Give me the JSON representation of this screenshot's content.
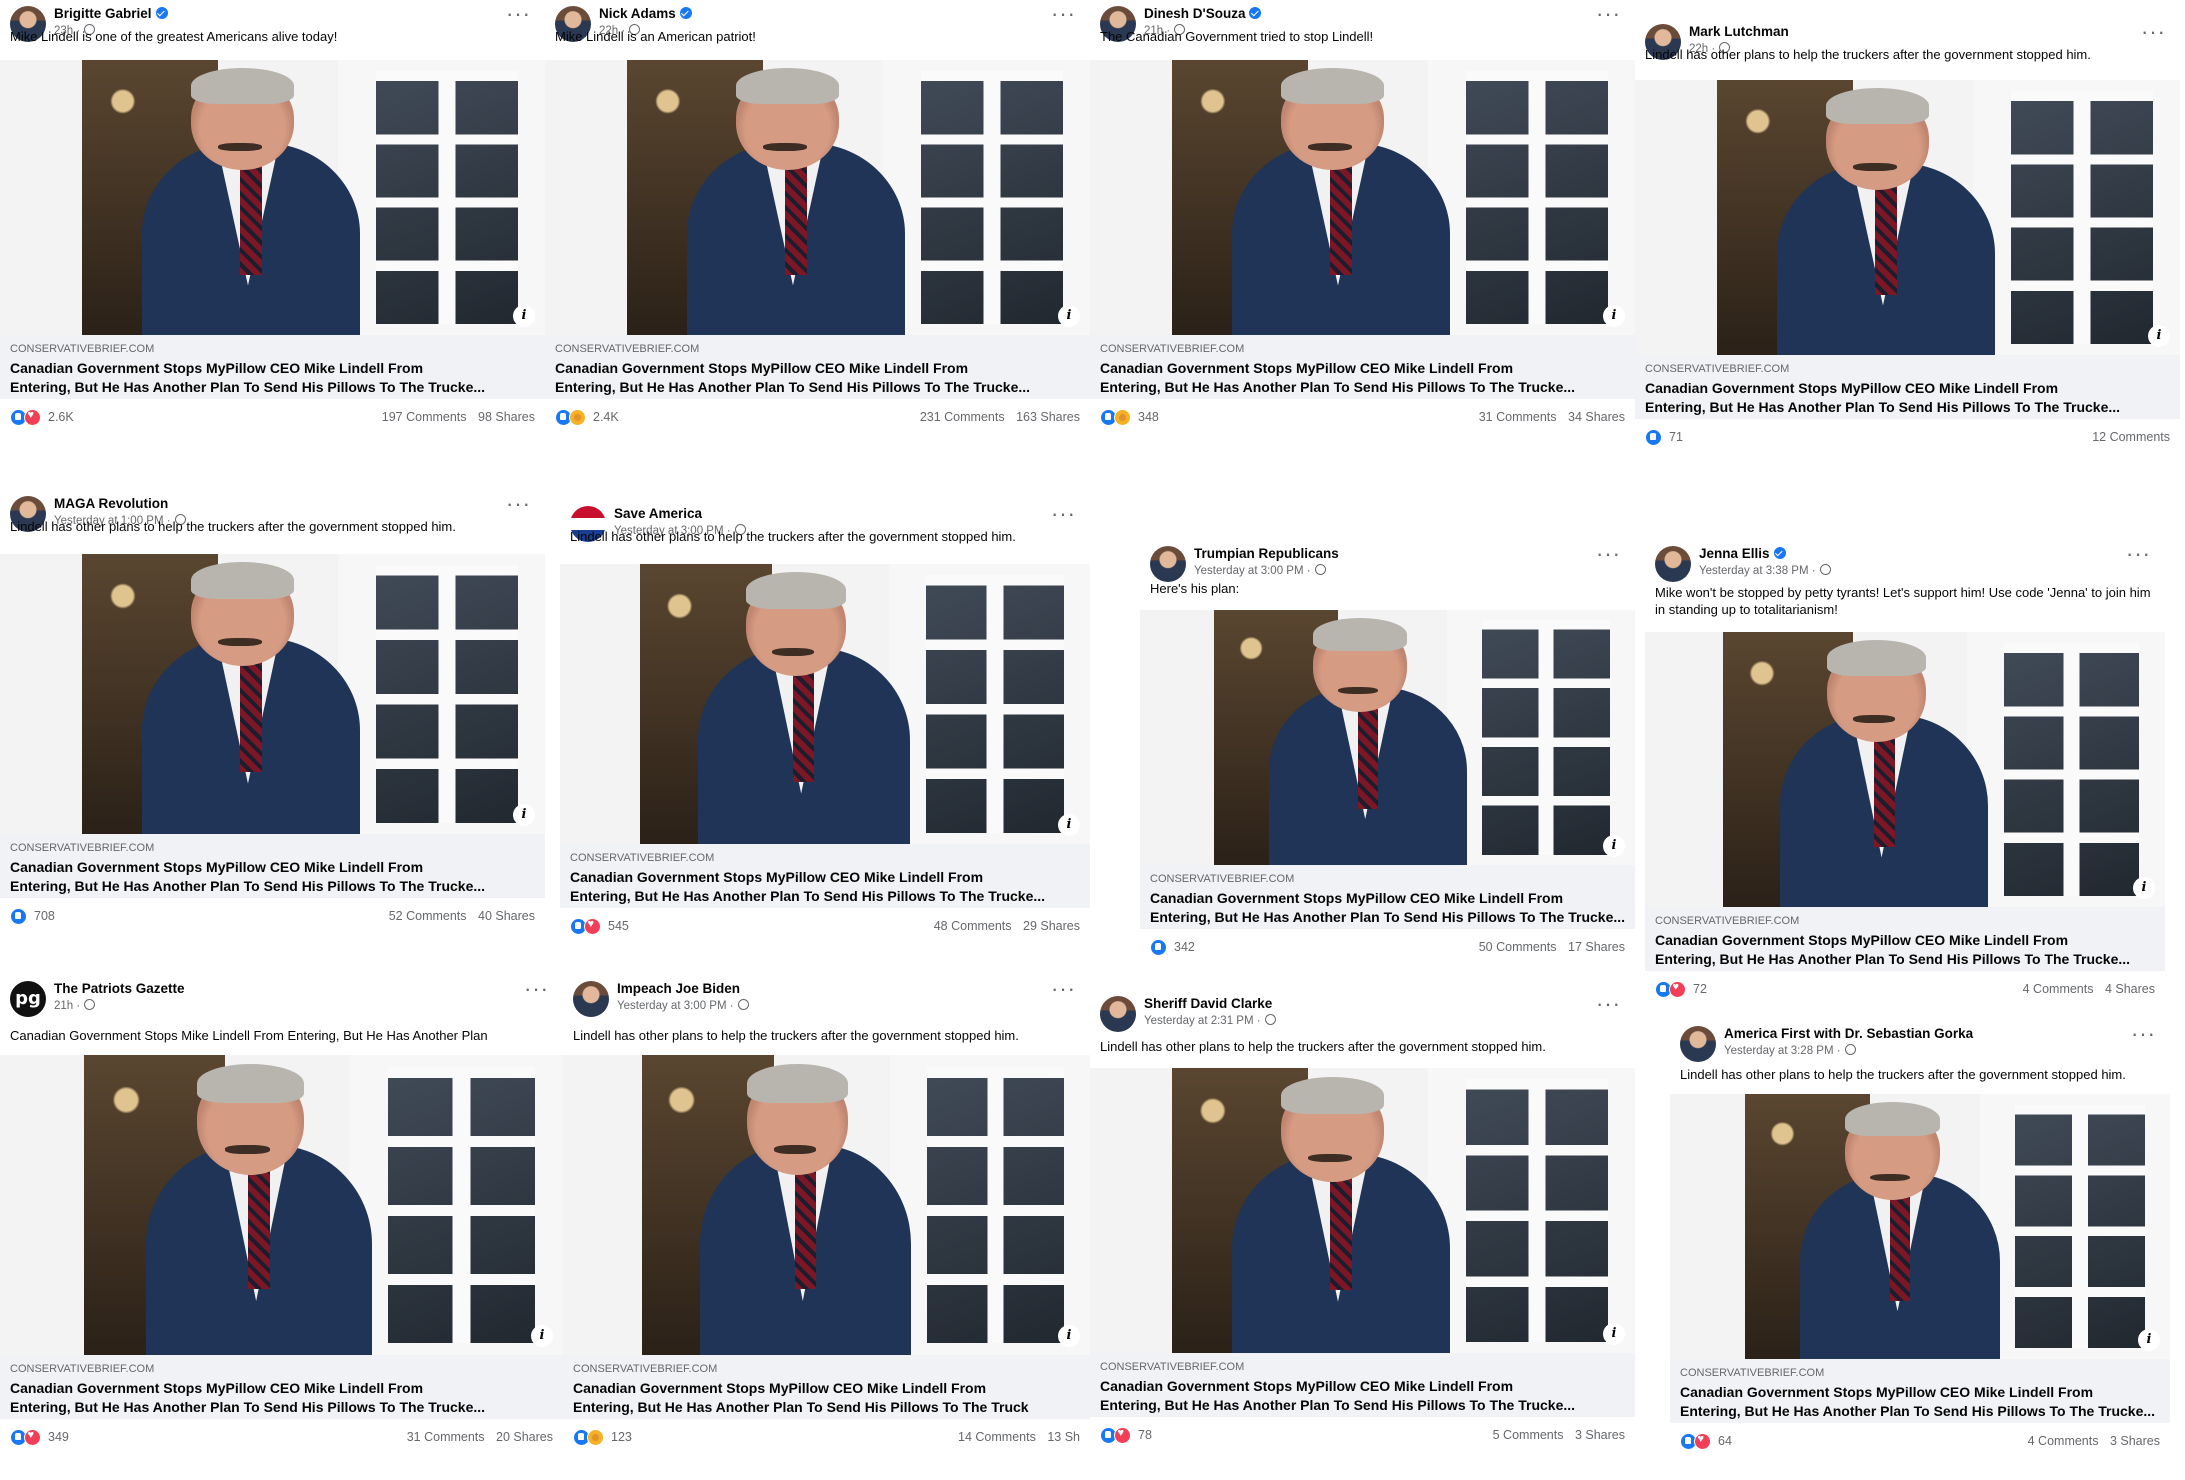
{
  "link_preview": {
    "domain": "CONSERVATIVEBRIEF.COM",
    "headline_line1": "Canadian Government Stops MyPillow CEO Mike Lindell From",
    "headline_line2": "Entering, But He Has Another Plan To Send His Pillows To The Trucke..."
  },
  "icons": {
    "more": "more-options-icon",
    "info": "info-icon",
    "globe": "globe-icon",
    "verified": "verified-badge-icon"
  },
  "colors": {
    "brand_blue": "#1877f2",
    "love_red": "#f33e58",
    "care_yellow": "#f7b125",
    "secondary_text": "#65676b",
    "link_bg": "#f0f2f5"
  },
  "posts": [
    {
      "page": "Brigitte Gabriel",
      "verified": true,
      "time": "23h",
      "caption": "Mike Lindell is one of the greatest Americans alive today!",
      "reactions": [
        "like",
        "love"
      ],
      "reaction_count": "2.6K",
      "comments": "197 Comments",
      "shares": "98 Shares",
      "headline_line2": "Entering, But He Has Another Plan To Send His Pillows To The Trucke..."
    },
    {
      "page": "Nick Adams",
      "verified": true,
      "time": "22h",
      "caption": "Mike Lindell is an American patriot!",
      "reactions": [
        "like",
        "care"
      ],
      "reaction_count": "2.4K",
      "comments": "231 Comments",
      "shares": "163 Shares",
      "headline_line2": "Entering, But He Has Another Plan To Send His Pillows To The Trucke..."
    },
    {
      "page": "Dinesh D'Souza",
      "verified": true,
      "time": "21h",
      "caption": "The Canadian Government tried to stop Lindell!",
      "reactions": [
        "like",
        "care"
      ],
      "reaction_count": "348",
      "comments": "31 Comments",
      "shares": "34 Shares",
      "headline_line2": "Entering, But He Has Another Plan To Send His Pillows To The Trucke..."
    },
    {
      "page": "Mark Lutchman",
      "verified": false,
      "time": "22h",
      "caption": "Lindell has other plans to help the truckers after the government stopped him.",
      "reactions": [
        "like"
      ],
      "reaction_count": "71",
      "comments": "12 Comments",
      "shares": "",
      "headline_line2": "Entering, But He Has Another Plan To Send His Pillows To The Trucke..."
    },
    {
      "page": "MAGA Revolution",
      "verified": false,
      "time": "Yesterday at 1:00 PM",
      "caption": "Lindell has other plans to help the truckers after the government stopped him.",
      "reactions": [
        "like"
      ],
      "reaction_count": "708",
      "comments": "52 Comments",
      "shares": "40 Shares",
      "headline_line2": "Entering, But He Has Another Plan To Send His Pillows To The Trucke..."
    },
    {
      "page": "Save America",
      "verified": false,
      "time": "Yesterday at 3:00 PM",
      "caption": "Lindell has other plans to help the truckers after the government stopped him.",
      "reactions": [
        "like",
        "love"
      ],
      "reaction_count": "545",
      "comments": "48 Comments",
      "shares": "29 Shares",
      "headline_line2": "Entering, But He Has Another Plan To Send His Pillows To The Trucke..."
    },
    {
      "page": "Trumpian Republicans",
      "verified": false,
      "time": "Yesterday at 3:00 PM",
      "caption": "Here's his plan:",
      "reactions": [
        "like"
      ],
      "reaction_count": "342",
      "comments": "50 Comments",
      "shares": "17 Shares",
      "headline_line2": "Entering, But He Has Another Plan To Send His Pillows To The Trucke..."
    },
    {
      "page": "Jenna Ellis",
      "verified": true,
      "time": "Yesterday at 3:38 PM",
      "caption": "Mike won't be stopped by petty tyrants! Let's support him! Use code 'Jenna' to join him in standing up to totalitarianism!",
      "reactions": [
        "like",
        "love"
      ],
      "reaction_count": "72",
      "comments": "4 Comments",
      "shares": "4 Shares",
      "headline_line2": "Entering, But He Has Another Plan To Send His Pillows To The Trucke..."
    },
    {
      "page": "The Patriots Gazette",
      "verified": false,
      "time": "21h",
      "caption": "Canadian Government Stops Mike Lindell From Entering, But He Has Another Plan",
      "reactions": [
        "like",
        "love"
      ],
      "reaction_count": "349",
      "comments": "31 Comments",
      "shares": "20 Shares",
      "headline_line2": "Entering, But He Has Another Plan To Send His Pillows To The Trucke..."
    },
    {
      "page": "Impeach Joe Biden",
      "verified": false,
      "time": "Yesterday at 3:00 PM",
      "caption": "Lindell has other plans to help the truckers after the government stopped him.",
      "reactions": [
        "like",
        "care"
      ],
      "reaction_count": "123",
      "comments": "14 Comments",
      "shares": "13 Sh",
      "headline_line2": "Entering, But He Has Another Plan To Send His Pillows To The Truck"
    },
    {
      "page": "Sheriff David Clarke",
      "verified": false,
      "time": "Yesterday at 2:31 PM",
      "caption": "Lindell has other plans to help the truckers after the government stopped him.",
      "reactions": [
        "like",
        "love"
      ],
      "reaction_count": "78",
      "comments": "5 Comments",
      "shares": "3 Shares",
      "headline_line2": "Entering, But He Has Another Plan To Send His Pillows To The Trucke..."
    },
    {
      "page": "America First with Dr. Sebastian Gorka",
      "verified": false,
      "time": "Yesterday at 3:28 PM",
      "caption": "Lindell has other plans to help the truckers after the government stopped him.",
      "reactions": [
        "like",
        "love"
      ],
      "reaction_count": "64",
      "comments": "4 Comments",
      "shares": "3 Shares",
      "headline_line2": "Entering, But He Has Another Plan To Send His Pillows To The Trucke..."
    }
  ]
}
